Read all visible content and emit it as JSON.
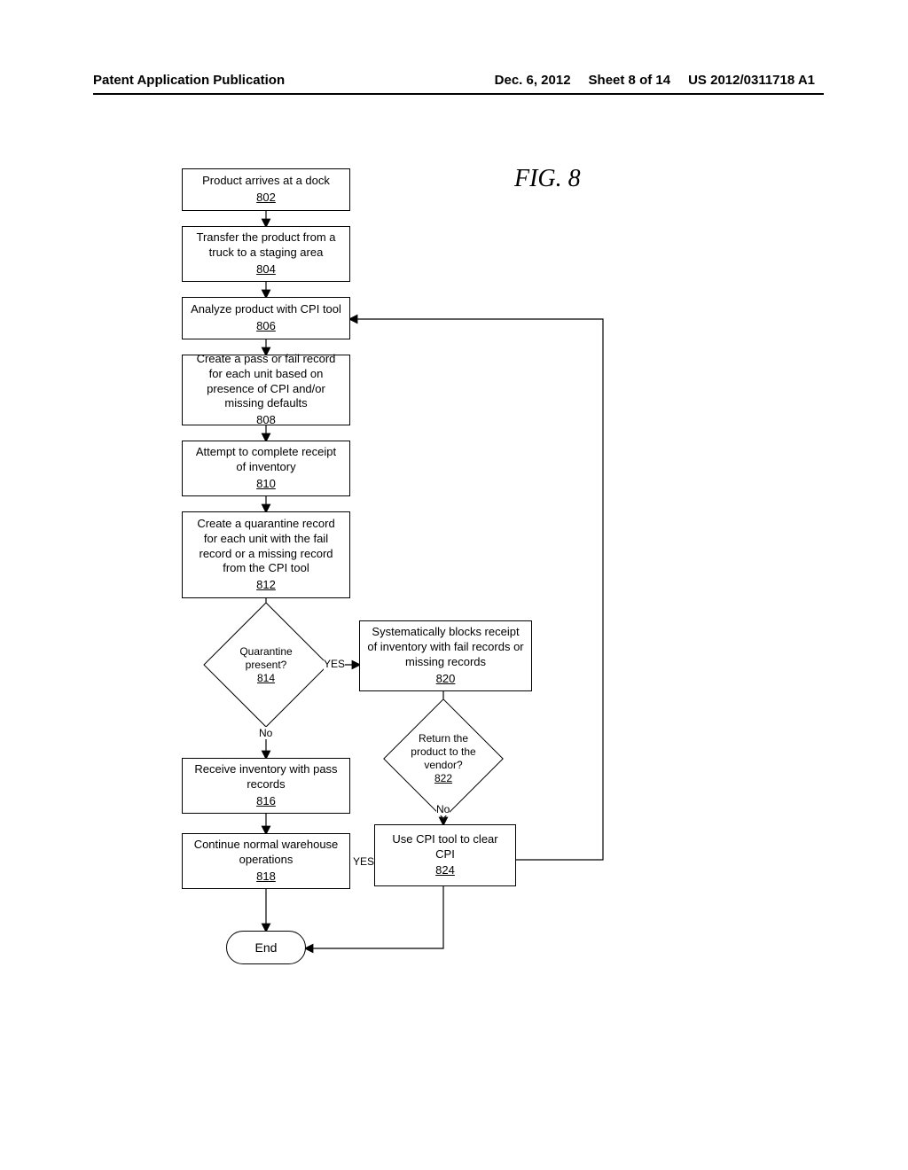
{
  "header": {
    "left": "Patent Application Publication",
    "date": "Dec. 6, 2012",
    "sheet": "Sheet 8 of 14",
    "pubno": "US 2012/0311718 A1"
  },
  "figure_label": "FIG. 8",
  "boxes": {
    "b802": {
      "text": "Product arrives at a dock",
      "ref": "802"
    },
    "b804": {
      "text": "Transfer the product from a truck to a staging area",
      "ref": "804"
    },
    "b806": {
      "text": "Analyze product with CPI tool",
      "ref": "806"
    },
    "b808": {
      "text": "Create a pass or fail record for each unit based on presence of CPI and/or missing defaults",
      "ref": "808"
    },
    "b810": {
      "text": "Attempt to complete receipt of inventory",
      "ref": "810"
    },
    "b812": {
      "text": "Create a quarantine record for each unit with the fail record or a missing record from the CPI tool",
      "ref": "812"
    },
    "b814": {
      "text": "Quarantine present?",
      "ref": "814"
    },
    "b816": {
      "text": "Receive inventory with pass records",
      "ref": "816"
    },
    "b818": {
      "text": "Continue normal warehouse operations",
      "ref": "818"
    },
    "b820": {
      "text": "Systematically blocks receipt of inventory with fail records or missing records",
      "ref": "820"
    },
    "b822": {
      "text": "Return the product to the vendor?",
      "ref": "822"
    },
    "b824": {
      "text": "Use CPI tool to clear CPI",
      "ref": "824"
    },
    "end": {
      "text": "End"
    }
  },
  "labels": {
    "yes814": "YES",
    "no814": "No",
    "no822": "No",
    "yes818": "YES"
  }
}
